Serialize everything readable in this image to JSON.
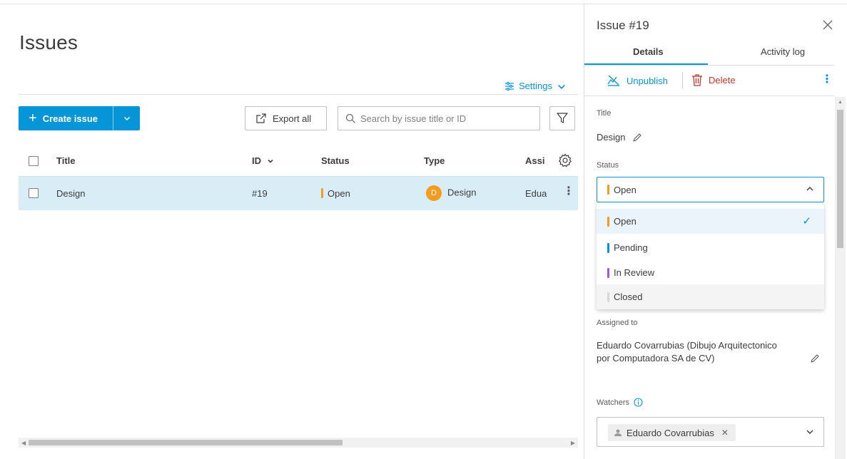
{
  "page": {
    "title": "Issues",
    "settings_label": "Settings",
    "create_label": "Create issue",
    "export_label": "Export all",
    "search_placeholder": "Search by issue title or ID"
  },
  "table": {
    "columns": {
      "title": "Title",
      "id": "ID",
      "status": "Status",
      "type": "Type",
      "assignee": "Assi"
    },
    "rows": [
      {
        "title": "Design",
        "id": "#19",
        "status": "Open",
        "status_color": "#f29d1f",
        "type_initial": "D",
        "type": "Design",
        "assignee": "Edua"
      }
    ]
  },
  "panel": {
    "title": "Issue #19",
    "tabs": [
      "Details",
      "Activity log"
    ],
    "unpublish_label": "Unpublish",
    "delete_label": "Delete",
    "title_label": "Title",
    "title_value": "Design",
    "status_label": "Status",
    "status_value": "Open",
    "status_options": [
      {
        "label": "Open",
        "color": "#f29d1f",
        "selected": true
      },
      {
        "label": "Pending",
        "color": "#0696d7",
        "selected": false
      },
      {
        "label": "In Review",
        "color": "#a05ad8",
        "selected": false
      },
      {
        "label": "Closed",
        "color": "#d6d6d6",
        "selected": false
      }
    ],
    "assigned_label": "Assigned to",
    "assigned_value": "Eduardo Covarrubias (Dibujo Arquitectonico por Computadora SA de CV)",
    "watchers_label": "Watchers",
    "watcher_chip": "Eduardo Covarrubias"
  },
  "colors": {
    "accent": "#0696d7",
    "danger": "#c0392b",
    "row_highlight": "#d9edf7"
  }
}
